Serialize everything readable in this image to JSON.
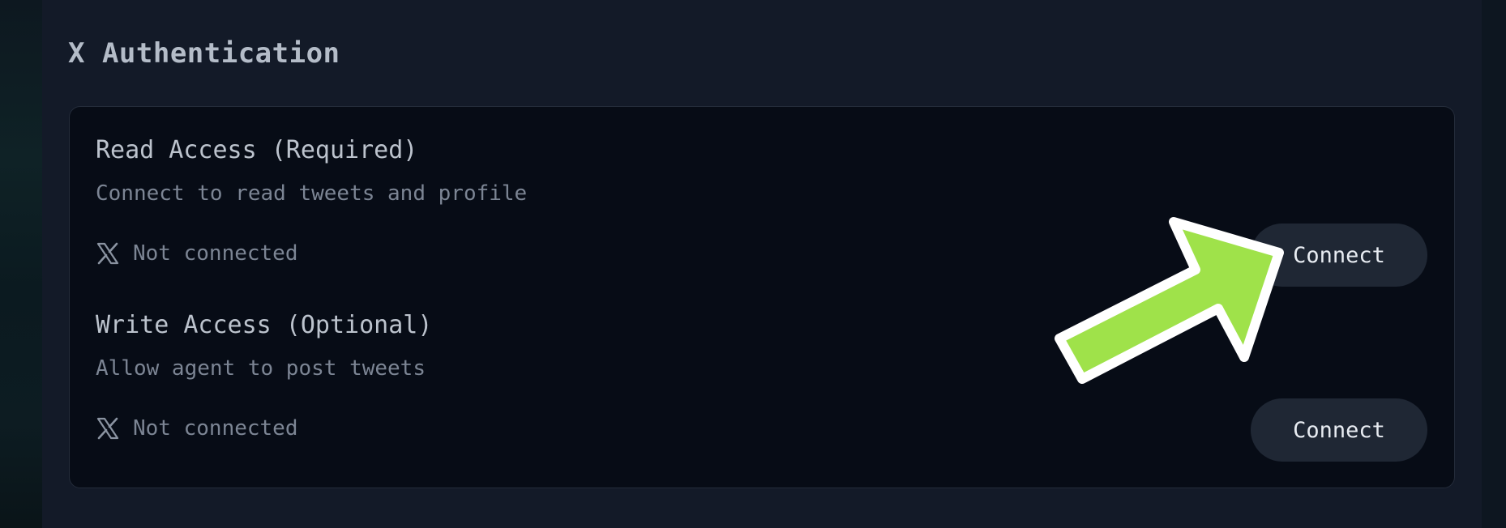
{
  "section": {
    "title": "X Authentication"
  },
  "read_access": {
    "title": "Read Access (Required)",
    "description": "Connect to read tweets and profile",
    "status": "Not connected",
    "button_label": "Connect"
  },
  "write_access": {
    "title": "Write Access (Optional)",
    "description": "Allow agent to post tweets",
    "status": "Not connected",
    "button_label": "Connect"
  },
  "colors": {
    "arrow_fill": "#9fe24a",
    "arrow_outline": "#ffffff",
    "button_bg": "#1f2734",
    "card_bg": "#070c16"
  },
  "icons": {
    "status_icon": "x-logo-icon",
    "annotation": "arrow-annotation-icon"
  }
}
